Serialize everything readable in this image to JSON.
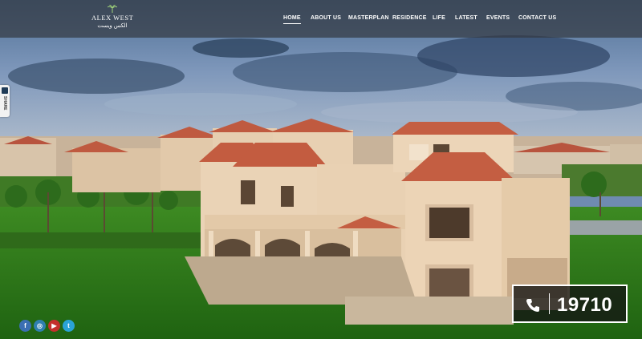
{
  "brand": {
    "name": "ALEX WEST",
    "name_ar": "الكس ويست"
  },
  "nav": {
    "items": [
      {
        "label": "HOME",
        "active": true
      },
      {
        "label": "ABOUT US"
      },
      {
        "label": "MASTERPLAN"
      },
      {
        "label": "RESIDENCE"
      },
      {
        "label": "LIFE"
      },
      {
        "label": "LATEST"
      },
      {
        "label": "EVENTS"
      },
      {
        "label": "CONTACT US"
      }
    ]
  },
  "share": {
    "label": "SHARE",
    "icon": "share-icon"
  },
  "social": [
    {
      "icon": "facebook-icon",
      "glyph": "f",
      "color": "#3b6fb3"
    },
    {
      "icon": "instagram-icon",
      "glyph": "◎",
      "color": "#2f7fb0"
    },
    {
      "icon": "youtube-icon",
      "glyph": "▶",
      "color": "#c4302b"
    },
    {
      "icon": "twitter-icon",
      "glyph": "t",
      "color": "#2aa3d6"
    }
  ],
  "hotline": {
    "number": "19710",
    "icon": "phone-icon"
  }
}
